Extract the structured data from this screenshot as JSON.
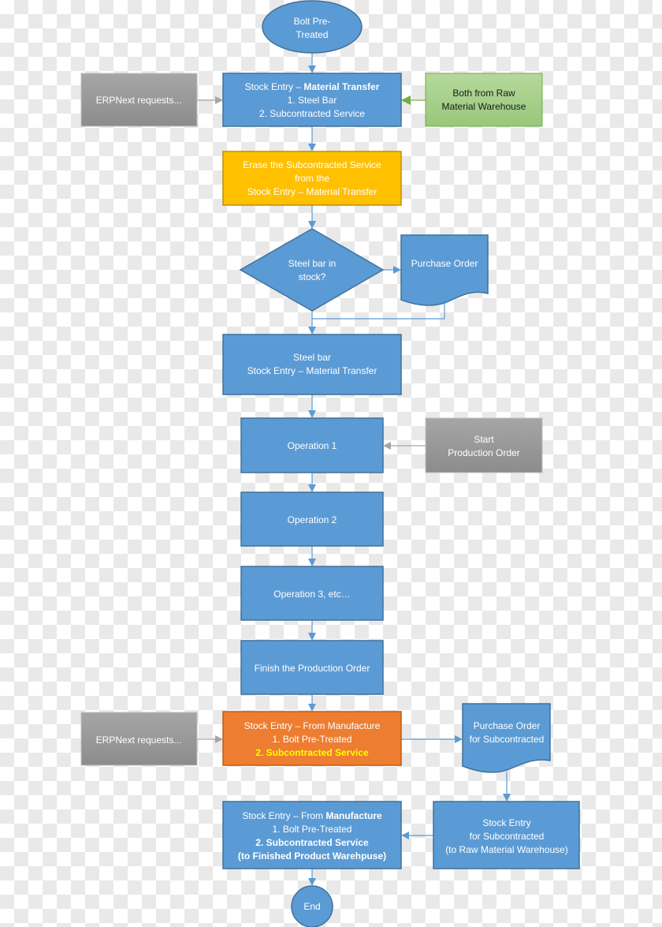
{
  "colors": {
    "process": "#5b9bd5",
    "highlight_yellow": "#ffc000",
    "highlight_orange": "#ed7d31",
    "external": "#a6a6a6",
    "source": "#a9d18e",
    "emphasis_text": "#ffff00"
  },
  "nodes": {
    "start": {
      "line1": "Bolt Pre-",
      "line2": "Treated"
    },
    "transfer": {
      "prefix": "Stock Entry – ",
      "bold": "Material Transfer",
      "line2": "1. Steel Bar",
      "line3": "2. Subcontracted Service"
    },
    "erp_request_1": "ERPNext requests...",
    "raw_source": {
      "line1": "Both from Raw",
      "line2": "Material Warehouse"
    },
    "erase": {
      "line1": "Erase the Subcontracted Service",
      "line2": "from the",
      "line3": "Stock Entry – Material Transfer"
    },
    "decision": {
      "line1": "Steel bar in",
      "line2": "stock?"
    },
    "purchase_order": "Purchase Order",
    "steel_transfer": {
      "line1": "Steel bar",
      "line2": "Stock Entry – Material Transfer"
    },
    "op1": "Operation 1",
    "start_production": {
      "line1": "Start",
      "line2": "Production Order"
    },
    "op2": "Operation 2",
    "op3": "Operation 3, etc…",
    "finish": "Finish the Production Order",
    "manufacture_1": {
      "line1": "Stock Entry – From  Manufacture",
      "line2": "1. Bolt Pre-Treated",
      "line3": "2. Subcontracted Service"
    },
    "erp_request_2": "ERPNext requests...",
    "po_sub": {
      "line1": "Purchase Order",
      "line2": "for Subcontracted"
    },
    "stock_sub": {
      "line1": "Stock Entry",
      "line2": "for Subcontracted",
      "line3": "(to Raw Material Warehouse)"
    },
    "manufacture_2": {
      "prefix": "Stock Entry – From  ",
      "bold": "Manufacture",
      "line2": "1. Bolt Pre-Treated",
      "line3": "2. Subcontracted Service",
      "line4": "(to Finished Product Warehpuse)"
    },
    "end": "End"
  }
}
